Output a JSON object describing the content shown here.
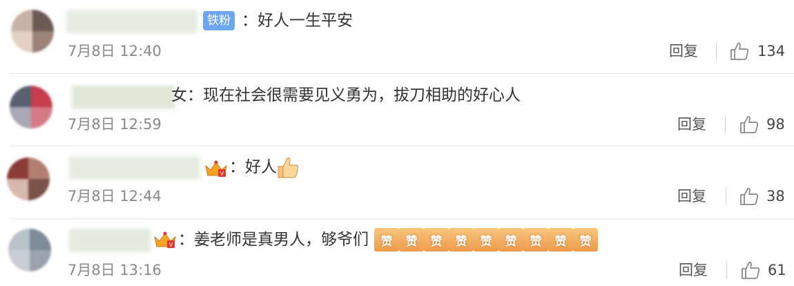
{
  "comments": [
    {
      "text": "：好人一生平安",
      "badge": "铁粉",
      "time": "7月8日 12:40",
      "reply_label": "回复",
      "likes": "134"
    },
    {
      "text": "女：现在社会很需要见义勇为，拔刀相助的好心人",
      "time": "7月8日 12:59",
      "reply_label": "回复",
      "likes": "98"
    },
    {
      "text": "：好人",
      "time": "7月8日 12:44",
      "reply_label": "回复",
      "likes": "38"
    },
    {
      "text": "：姜老师是真男人，够爷们",
      "time": "7月8日 13:16",
      "reply_label": "回复",
      "likes": "61",
      "emoji_label": "赞"
    }
  ],
  "colors": {
    "badge": "#6da6ef",
    "text": "#333333",
    "meta": "#888888",
    "divider": "#e6e6e6"
  }
}
